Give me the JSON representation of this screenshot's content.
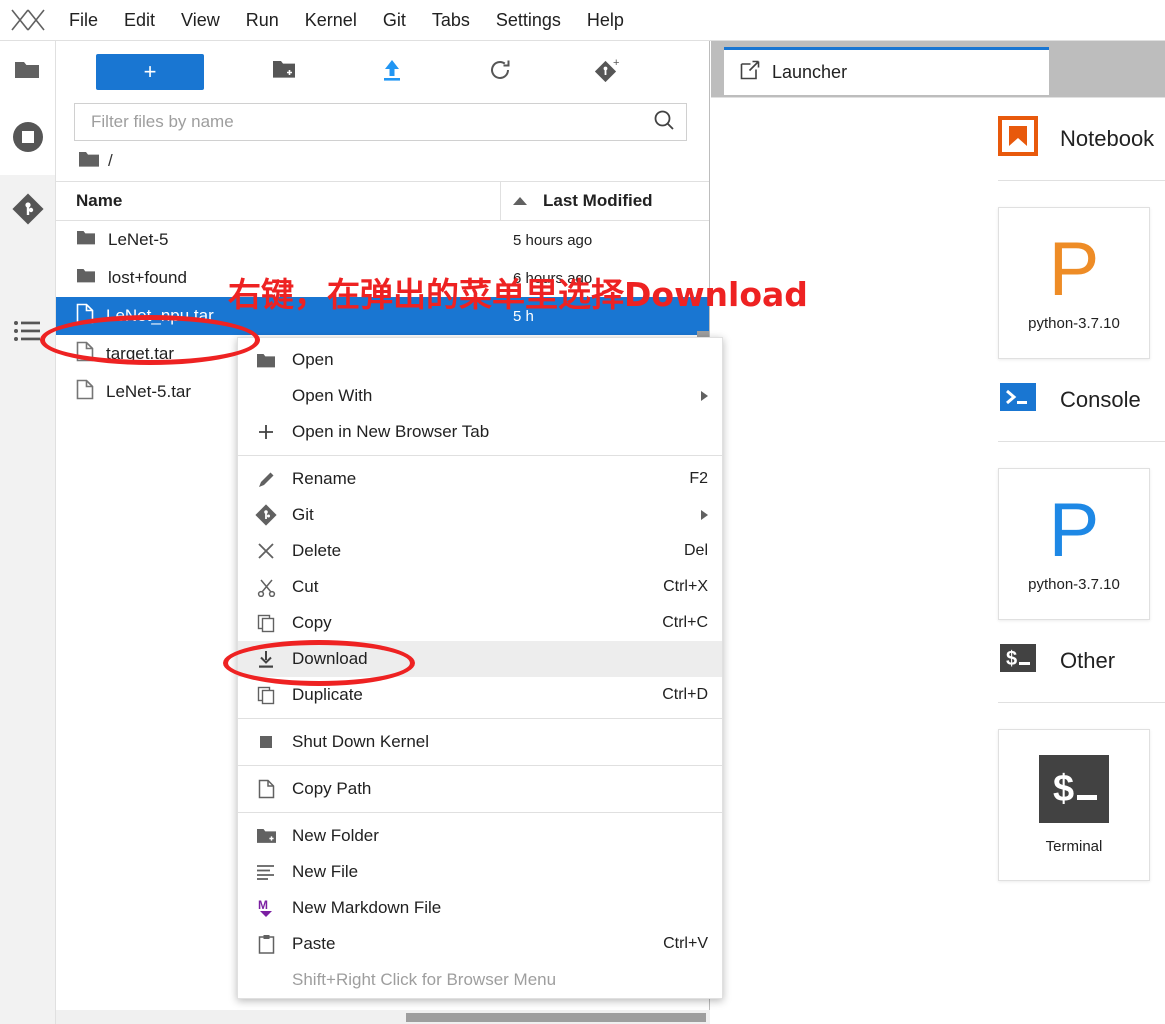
{
  "app": {
    "logo_icon": "jupyter-logo-icon",
    "menus": [
      "File",
      "Edit",
      "View",
      "Run",
      "Kernel",
      "Git",
      "Tabs",
      "Settings",
      "Help"
    ]
  },
  "activity_bar": {
    "items": [
      {
        "name": "file-browser",
        "icon": "folder-icon"
      },
      {
        "name": "running-terminals-kernels",
        "icon": "stop-circle-icon",
        "active": true
      },
      {
        "name": "git-panel",
        "icon": "git-diamond-icon"
      },
      {
        "name": "table-of-contents",
        "icon": "list-icon"
      }
    ]
  },
  "file_browser": {
    "toolbar": {
      "new_launcher_label": "+",
      "new_folder_icon": "new-folder-icon",
      "upload_icon": "upload-arrow-icon",
      "refresh_icon": "refresh-icon",
      "git_clone_icon": "git-add-icon"
    },
    "filter": {
      "placeholder": "Filter files by name",
      "value": "",
      "search_icon": "search-icon"
    },
    "breadcrumb": {
      "root_icon": "folder-icon",
      "path": "/"
    },
    "columns": {
      "name": "Name",
      "last_modified": "Last Modified",
      "sort_indicator": "sort-ascending-caret"
    },
    "rows": [
      {
        "name": "LeNet-5",
        "type": "folder",
        "icon": "folder-icon",
        "modified": "5 hours ago",
        "selected": false
      },
      {
        "name": "lost+found",
        "type": "folder",
        "icon": "folder-icon",
        "modified": "6 hours ago",
        "selected": false
      },
      {
        "name": "LeNet_npu.tar",
        "type": "file",
        "icon": "file-icon",
        "modified": "5 h",
        "selected": true
      },
      {
        "name": "target.tar",
        "type": "file",
        "icon": "file-icon",
        "modified": "",
        "selected": false
      },
      {
        "name": "LeNet-5.tar",
        "type": "file",
        "icon": "file-icon",
        "modified": "",
        "selected": false
      }
    ]
  },
  "context_menu": {
    "groups": [
      {
        "items": [
          {
            "label": "Open",
            "underline": "O",
            "icon": "folder-icon",
            "shortcut": "",
            "submenu": false,
            "highlight": false,
            "disabled": false
          },
          {
            "label": "Open With",
            "underline": "",
            "icon": "",
            "shortcut": "",
            "submenu": true,
            "highlight": false,
            "disabled": false
          },
          {
            "label": "Open in New Browser Tab",
            "underline": "O",
            "icon": "plus-icon",
            "shortcut": "",
            "submenu": false,
            "highlight": false,
            "disabled": false
          }
        ]
      },
      {
        "items": [
          {
            "label": "Rename",
            "underline": "R",
            "icon": "pencil-icon",
            "shortcut": "F2",
            "submenu": false,
            "highlight": false,
            "disabled": false
          },
          {
            "label": "Git",
            "underline": "",
            "icon": "git-diamond-icon",
            "shortcut": "",
            "submenu": true,
            "highlight": false,
            "disabled": false
          },
          {
            "label": "Delete",
            "underline": "D",
            "icon": "close-x-icon",
            "shortcut": "Del",
            "submenu": false,
            "highlight": false,
            "disabled": false
          },
          {
            "label": "Cut",
            "underline": "",
            "icon": "scissors-icon",
            "shortcut": "Ctrl+X",
            "submenu": false,
            "highlight": false,
            "disabled": false
          },
          {
            "label": "Copy",
            "underline": "C",
            "icon": "copy-icon",
            "shortcut": "Ctrl+C",
            "submenu": false,
            "highlight": false,
            "disabled": false
          },
          {
            "label": "Download",
            "underline": "",
            "icon": "download-icon",
            "shortcut": "",
            "submenu": false,
            "highlight": true,
            "disabled": false
          },
          {
            "label": "Duplicate",
            "underline": "",
            "icon": "copy-icon",
            "shortcut": "Ctrl+D",
            "submenu": false,
            "highlight": false,
            "disabled": false
          }
        ]
      },
      {
        "items": [
          {
            "label": "Shut Down Kernel",
            "underline": "",
            "icon": "stop-square-icon",
            "shortcut": "",
            "submenu": false,
            "highlight": false,
            "disabled": false
          }
        ]
      },
      {
        "items": [
          {
            "label": "Copy Path",
            "underline": "",
            "icon": "file-icon",
            "shortcut": "",
            "submenu": false,
            "highlight": false,
            "disabled": false
          }
        ]
      },
      {
        "items": [
          {
            "label": "New Folder",
            "underline": "",
            "icon": "new-folder-icon",
            "shortcut": "",
            "submenu": false,
            "highlight": false,
            "disabled": false
          },
          {
            "label": "New File",
            "underline": "",
            "icon": "text-lines-icon",
            "shortcut": "",
            "submenu": false,
            "highlight": false,
            "disabled": false
          },
          {
            "label": "New Markdown File",
            "underline": "",
            "icon": "markdown-icon",
            "shortcut": "",
            "submenu": false,
            "highlight": false,
            "disabled": false
          },
          {
            "label": "Paste",
            "underline": "P",
            "icon": "clipboard-icon",
            "shortcut": "Ctrl+V",
            "submenu": false,
            "highlight": false,
            "disabled": false
          },
          {
            "label": "Shift+Right Click for Browser Menu",
            "underline": "",
            "icon": "",
            "shortcut": "",
            "submenu": false,
            "highlight": false,
            "disabled": true
          }
        ]
      }
    ]
  },
  "main_area": {
    "tabs": [
      {
        "label": "Launcher",
        "icon": "launcher-icon",
        "active": true
      }
    ],
    "launcher": {
      "sections": [
        {
          "title": "Notebook",
          "icon": "notebook-bookmark-icon",
          "icon_color": "#e8590c",
          "cards": [
            {
              "label": "python-3.7.10",
              "glyph": "P",
              "glyph_color": "#ee8c26"
            }
          ]
        },
        {
          "title": "Console",
          "icon": "console-prompt-icon",
          "icon_color": "#1976d2",
          "cards": [
            {
              "label": "python-3.7.10",
              "glyph": "P",
              "glyph_color": "#1e88e5"
            }
          ]
        },
        {
          "title": "Other",
          "icon": "terminal-prompt-icon",
          "icon_color": "#424242",
          "cards": [
            {
              "label": "Terminal",
              "glyph": "$_",
              "glyph_color": "#ffffff"
            }
          ]
        }
      ]
    }
  },
  "annotations": {
    "instruction_text": "右键，在弹出的菜单里选择Download",
    "color": "#ee2222",
    "highlight_file": "LeNet_npu.tar",
    "highlight_menu_item": "Download"
  },
  "colors": {
    "accent_blue": "#1976d2",
    "selection_blue": "#1976d2",
    "annotation_red": "#ee2222",
    "tabbar_gray": "#bdbdbd",
    "orange": "#e8590c"
  }
}
